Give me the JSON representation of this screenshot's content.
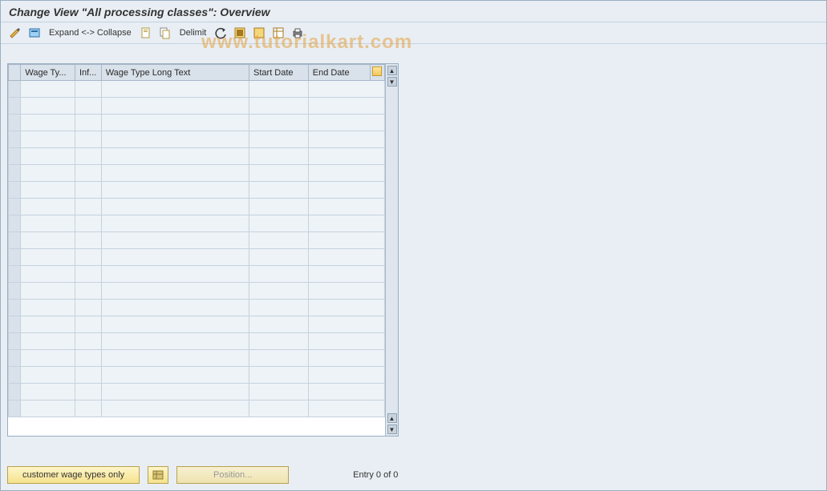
{
  "title": "Change View \"All processing classes\": Overview",
  "toolbar": {
    "expand_collapse": "Expand <-> Collapse",
    "delimit": "Delimit"
  },
  "columns": {
    "wage_type": "Wage Ty...",
    "inf": "Inf...",
    "long_text": "Wage Type Long Text",
    "start_date": "Start Date",
    "end_date": "End Date"
  },
  "rows": [
    {},
    {},
    {},
    {},
    {},
    {},
    {},
    {},
    {},
    {},
    {},
    {},
    {},
    {},
    {},
    {},
    {},
    {},
    {},
    {}
  ],
  "footer": {
    "customer_btn": "customer wage types only",
    "position_btn": "Position...",
    "entry_text": "Entry 0 of 0"
  },
  "watermark": "www.tutorialkart.com"
}
